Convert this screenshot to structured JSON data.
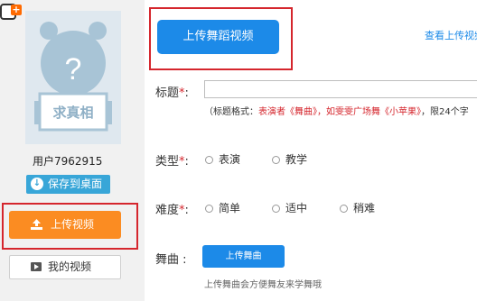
{
  "header_icon": "add-upload-icon",
  "sidebar": {
    "avatar": {
      "question_mark": "?",
      "placard_text": "求真相"
    },
    "username": "用户7962915",
    "save_button_label": "保存到桌面",
    "upload_button_label": "上传视频",
    "my_videos_label": "我的视频"
  },
  "main": {
    "upload_dance_label": "上传舞蹈视频",
    "view_upload_link": "查看上传视频",
    "title_field": {
      "label": "标题",
      "required_mark": "*",
      "colon": ":",
      "value": "",
      "hint_prefix": "（标题格式：",
      "hint_example": "表演者《舞曲》，如雯雯广场舞《小苹果》",
      "hint_suffix": "，限24个字"
    },
    "type_field": {
      "label": "类型",
      "required_mark": "*",
      "colon": ":",
      "options": [
        "表演",
        "教学"
      ]
    },
    "difficulty_field": {
      "label": "难度",
      "required_mark": "*",
      "colon": ":",
      "options": [
        "简单",
        "适中",
        "稍难"
      ]
    },
    "song_field": {
      "label": "舞曲",
      "colon": ":",
      "button_label": "上传舞曲",
      "hint": "上传舞曲会方便舞友来学舞哦"
    }
  },
  "colors": {
    "primary_blue": "#1c8ae8",
    "save_blue": "#38a6d8",
    "upload_orange": "#fb8c22",
    "highlight_red": "#d5262d",
    "avatar_bg": "#dfe8ef",
    "avatar_figure": "#a8c4d6"
  }
}
